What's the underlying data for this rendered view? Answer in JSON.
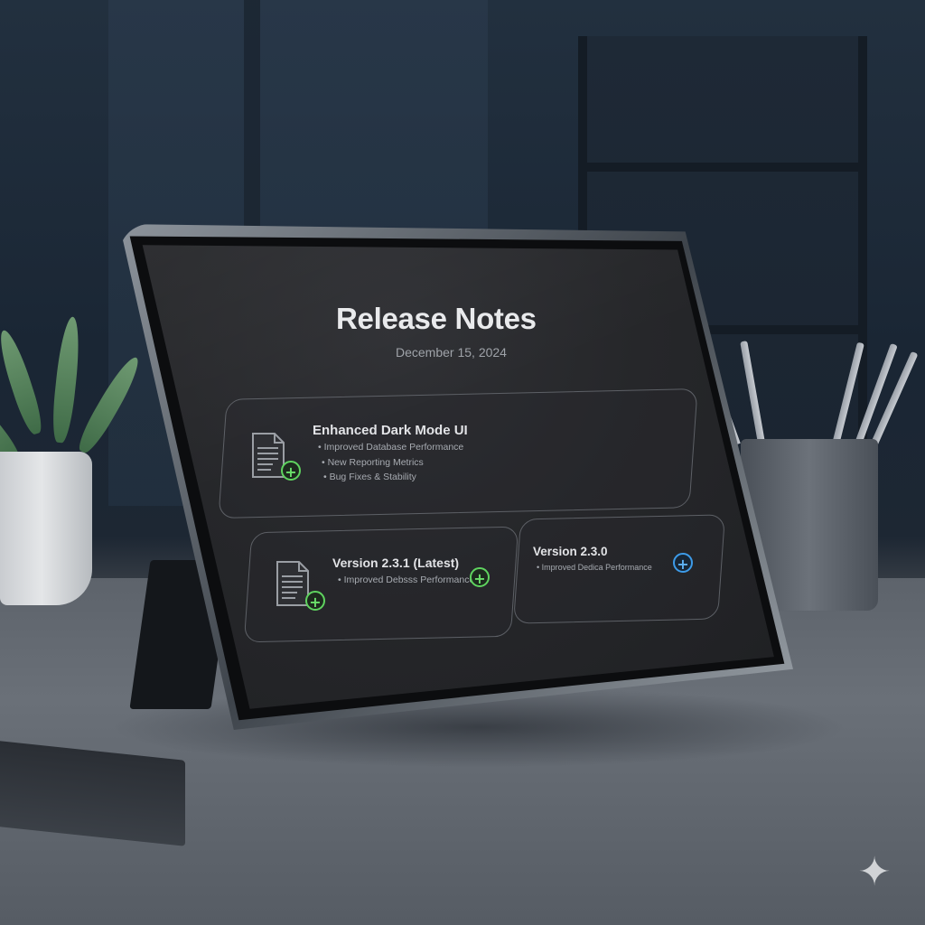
{
  "page": {
    "title": "Release Notes",
    "date": "December 15, 2024"
  },
  "cards": [
    {
      "title": "Enhanced Dark Mode UI",
      "icon": "document-add-icon",
      "badge_color": "#5fd35f",
      "bullets": [
        "• Improved Database Performance",
        "• New Reporting Metrics",
        "• Bug Fixes & Stability"
      ]
    },
    {
      "title": "Version 2.3.1 (Latest)",
      "icon": "document-add-icon",
      "badge_color": "#5fd35f",
      "bullets": [
        "• Improved Debsss Performance"
      ]
    },
    {
      "title": "Version 2.3.0",
      "icon": "plus-circle-icon",
      "badge_color": "#3d9be8",
      "bullets": [
        "• Improved Dedica Performance"
      ]
    }
  ],
  "colors": {
    "screen_bg": "#26272a",
    "accent_green": "#5fd35f",
    "accent_blue": "#3d9be8",
    "text_primary": "#e9eaec",
    "text_secondary": "#9ea2a8"
  }
}
